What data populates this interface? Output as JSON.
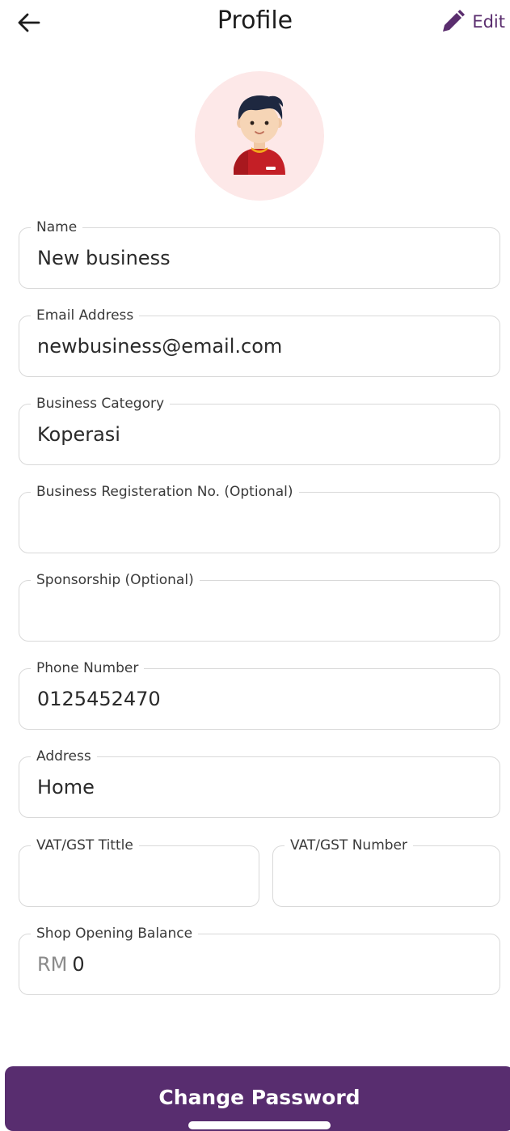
{
  "header": {
    "title": "Profile",
    "back_icon": "arrow-left-icon",
    "edit_label": "Edit",
    "edit_icon": "pencil-icon",
    "accent_color": "#5a2d6e"
  },
  "avatar": {
    "icon": "user-avatar-icon",
    "background": "#fde8e8"
  },
  "fields": {
    "name": {
      "label": "Name",
      "value": "New business"
    },
    "email": {
      "label": "Email Address",
      "value": "newbusiness@email.com"
    },
    "category": {
      "label": "Business Category",
      "value": "Koperasi"
    },
    "registration": {
      "label": "Business Registeration No. (Optional)",
      "value": ""
    },
    "sponsorship": {
      "label": "Sponsorship (Optional)",
      "value": ""
    },
    "phone": {
      "label": "Phone Number",
      "value": "0125452470"
    },
    "address": {
      "label": "Address",
      "value": "Home"
    },
    "vat_title": {
      "label": "VAT/GST Tittle",
      "value": ""
    },
    "vat_number": {
      "label": "VAT/GST Number",
      "value": ""
    },
    "opening_balance": {
      "label": "Shop Opening Balance",
      "currency": "RM",
      "value": "0"
    }
  },
  "actions": {
    "change_password_label": "Change Password",
    "button_color": "#582d6f"
  }
}
